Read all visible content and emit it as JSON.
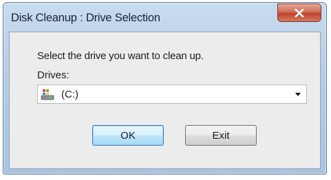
{
  "window": {
    "title": "Disk Cleanup : Drive Selection"
  },
  "dialog": {
    "prompt": "Select the drive you want to clean up.",
    "drives_label": "Drives:",
    "selected_drive": "(C:)",
    "ok_label": "OK",
    "exit_label": "Exit"
  },
  "icons": {
    "close": "close-icon",
    "drive": "drive-icon",
    "dropdown": "chevron-down-icon"
  },
  "colors": {
    "close_button": "#c8503a",
    "default_button_border": "#3c7fb1"
  }
}
